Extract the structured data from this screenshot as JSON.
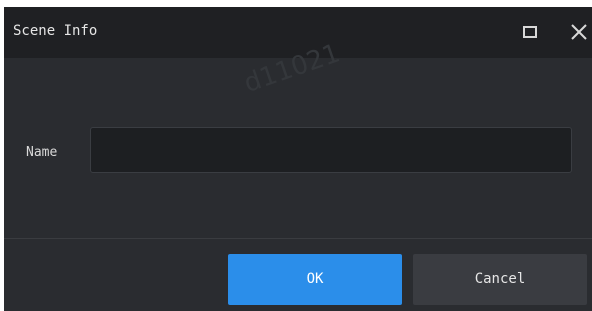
{
  "dialog": {
    "title": "Scene Info",
    "watermark": "d11021",
    "icons": {
      "maximize": "maximize-icon",
      "close": "close-icon"
    }
  },
  "form": {
    "name_label": "Name",
    "name_value": "",
    "name_placeholder": ""
  },
  "buttons": {
    "ok_label": "OK",
    "cancel_label": "Cancel"
  },
  "colors": {
    "titlebar": "#1f2023",
    "body": "#2a2c30",
    "input_bg": "#1d1f22",
    "ok_button": "#2b8eea",
    "cancel_button": "#3a3c41"
  }
}
